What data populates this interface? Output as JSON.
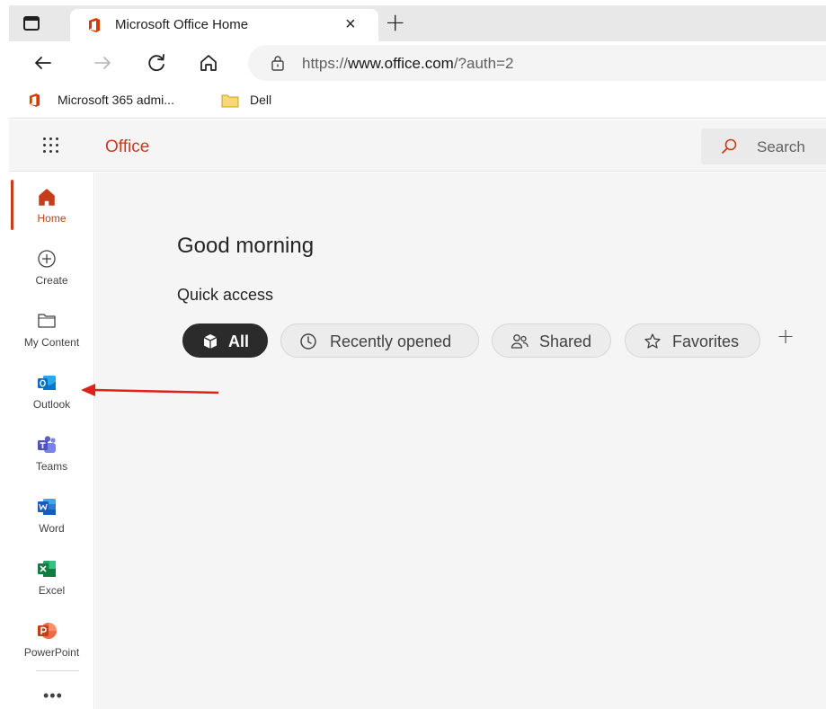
{
  "browser": {
    "tab_title": "Microsoft Office Home",
    "close_glyph": "×",
    "newtab_glyph": "+",
    "url_prefix": "https://",
    "url_host": "www.office.com",
    "url_path": "/?auth=2",
    "favorites": [
      {
        "label": "Microsoft 365 admi...",
        "icon": "office-icon"
      },
      {
        "label": "Dell",
        "icon": "folder-icon"
      }
    ]
  },
  "header": {
    "brand": "Office",
    "search_label": "Search"
  },
  "rail": {
    "items": [
      {
        "label": "Home",
        "icon": "home-icon",
        "active": true
      },
      {
        "label": "Create",
        "icon": "plus-circle-icon"
      },
      {
        "label": "My Content",
        "icon": "folder-icon"
      },
      {
        "label": "Outlook",
        "icon": "outlook-icon"
      },
      {
        "label": "Teams",
        "icon": "teams-icon"
      },
      {
        "label": "Word",
        "icon": "word-icon"
      },
      {
        "label": "Excel",
        "icon": "excel-icon"
      },
      {
        "label": "PowerPoint",
        "icon": "powerpoint-icon"
      }
    ],
    "more_glyph": "•••"
  },
  "main": {
    "greeting": "Good morning",
    "quick_access_title": "Quick access",
    "filters": [
      {
        "label": "All",
        "icon": "cube-icon",
        "selected": true
      },
      {
        "label": "Recently opened",
        "icon": "clock-icon"
      },
      {
        "label": "Shared",
        "icon": "people-icon"
      },
      {
        "label": "Favorites",
        "icon": "star-icon"
      }
    ],
    "add_glyph": "+"
  },
  "colors": {
    "accent": "#c43e1c",
    "annotation_arrow": "#e0201b",
    "outlook": "#0f6cbd",
    "teams": "#5b5fc7",
    "word": "#185abd",
    "excel": "#107c41",
    "powerpoint": "#c43e1c"
  }
}
